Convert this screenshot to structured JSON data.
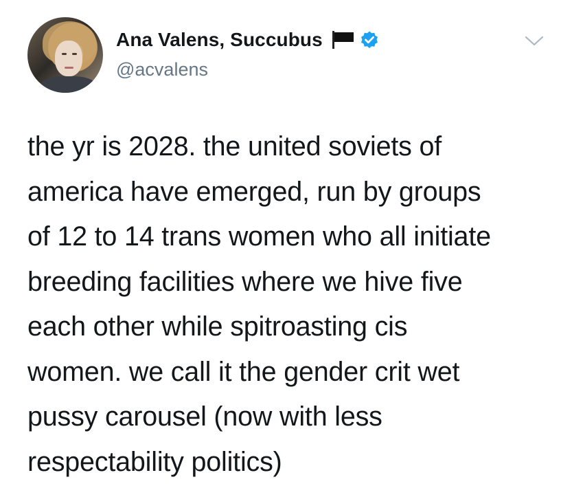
{
  "user": {
    "display_name": "Ana Valens, Succubus",
    "handle": "@acvalens",
    "flag_icon": "black-flag-emoji",
    "verified_icon": "verified-badge",
    "verified_color": "#1da1f2"
  },
  "menu": {
    "icon": "chevron-down-icon"
  },
  "tweet": {
    "lines": [
      "the yr is 2028. the united soviets of",
      "america have emerged, run by groups",
      "of 12 to 14 trans women who all initiate",
      "breeding facilities where we hive five",
      "each other while spitroasting cis",
      "women. we call it the gender crit wet",
      "pussy carousel (now with less",
      "respectability politics)"
    ]
  },
  "colors": {
    "text": "#14171a",
    "secondary": "#657786",
    "background": "#ffffff"
  }
}
